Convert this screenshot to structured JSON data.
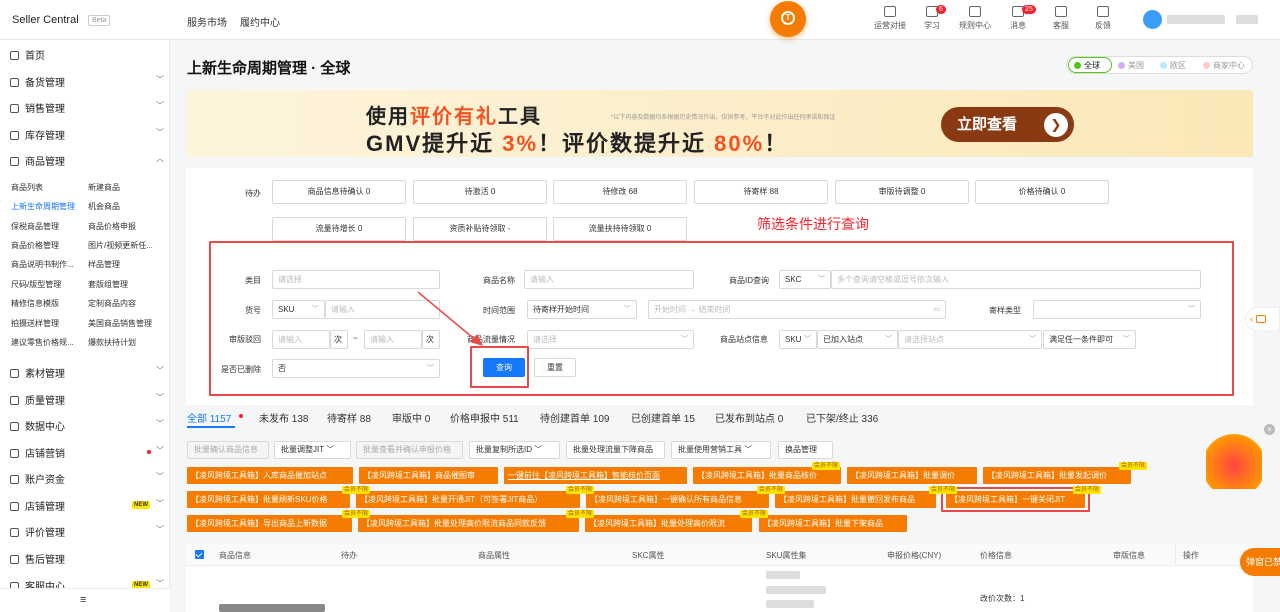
{
  "topbar": {
    "brand": "Seller Central",
    "beta": "Beta",
    "nav": [
      "服务市场",
      "履约中心"
    ],
    "logo_letter": "T",
    "icons": [
      {
        "name": "operations-icon",
        "label": "运营对接",
        "badge": ""
      },
      {
        "name": "learn-icon",
        "label": "学习",
        "badge": "6"
      },
      {
        "name": "rules-icon",
        "label": "规则中心",
        "badge": ""
      },
      {
        "name": "message-icon",
        "label": "消息",
        "badge": "25"
      },
      {
        "name": "customer-service-icon",
        "label": "客服",
        "badge": ""
      },
      {
        "name": "feedback-icon",
        "label": "反馈",
        "badge": ""
      }
    ]
  },
  "sidebar": {
    "menus": [
      {
        "label": "首页",
        "chev": ""
      },
      {
        "label": "备货管理",
        "chev": "﹀"
      },
      {
        "label": "销售管理",
        "chev": "﹀"
      },
      {
        "label": "库存管理",
        "chev": "﹀"
      },
      {
        "label": "商品管理",
        "chev": "︿"
      }
    ],
    "subs": [
      [
        "商品列表",
        "新建商品"
      ],
      [
        "上新生命周期管理",
        "机会商品"
      ],
      [
        "保税商品管理",
        "商品价格申报"
      ],
      [
        "商品价格管理",
        "图片/视频更新任..."
      ],
      [
        "商品说明书制作...",
        "样品管理"
      ],
      [
        "尺码/版型管理",
        "套版组管理"
      ],
      [
        "精修信息模版",
        "定制商品内容"
      ],
      [
        "拍摄送样管理",
        "美国商品销售管理"
      ],
      [
        "建议零售价格规...",
        "爆款扶持计划"
      ]
    ],
    "menus2": [
      {
        "label": "素材管理",
        "chev": "﹀"
      },
      {
        "label": "质量管理",
        "chev": "﹀"
      },
      {
        "label": "数据中心",
        "chev": "﹀"
      },
      {
        "label": "店铺营销",
        "chev": "﹀"
      },
      {
        "label": "账户资金",
        "chev": "﹀"
      },
      {
        "label": "店铺管理",
        "chev": "﹀"
      },
      {
        "label": "评价管理",
        "chev": "﹀"
      },
      {
        "label": "售后管理",
        "chev": ""
      },
      {
        "label": "客服中心",
        "chev": "﹀"
      }
    ],
    "new_tag": "NEW",
    "collapse_icon": "≡"
  },
  "page": {
    "title": "上新生命周期管理 · 全球",
    "regions": [
      "全球",
      "美国",
      "欧区",
      "商家中心"
    ],
    "region_colors": [
      "#52c41a",
      "#b37feb",
      "#69c0ff",
      "#ff7875"
    ]
  },
  "banner": {
    "line1_a": "使用",
    "line1_hl": "评价有礼",
    "line1_b": "工具",
    "line2_a": "GMV提升近 ",
    "line2_hl1": "3%",
    "line2_b": "！评价数提升近 ",
    "line2_hl2": "80%",
    "line2_c": "！",
    "note": "*以下内容及数据均系根据历史情况作出，仅供参考。平台不对此作出任何承诺和保证",
    "cta": "立即查看",
    "cta_arrow": "❯"
  },
  "todo": {
    "label": "待办",
    "items": [
      "商品信息待确认 0",
      "待激活 0",
      "待修改 68",
      "待寄样 88",
      "审版待调整 0",
      "价格待确认 0",
      "流量待增长 0",
      "资质补贴待领取 -",
      "流量扶持待领取 0"
    ]
  },
  "annotation": "筛选条件进行查询",
  "filters": {
    "category_label": "类目",
    "category_ph": "请选择",
    "product_name_label": "商品名称",
    "product_name_ph": "请输入",
    "product_id_label": "商品ID查询",
    "product_id_type": "SKC",
    "product_id_ph": "多个查询请空格或逗号依次输入",
    "sku_label": "货号",
    "sku_type": "SKU",
    "sku_ph": "请输入",
    "time_label": "时间范围",
    "time_type": "待寄样开始时间",
    "time_start_ph": "开始时间",
    "time_sep": "→",
    "time_end_ph": "结束时间",
    "sample_label": "寄样类型",
    "review_label": "审版驳回",
    "review_min_ph": "请输入",
    "review_unit": "次",
    "review_sep": "~",
    "review_max_ph": "请输入",
    "traffic_label": "商品流量情况",
    "traffic_ph": "请选择",
    "site_label": "商品站点信息",
    "site_type": "SKU",
    "site_status": "已加入站点",
    "site_ph": "请选择站点",
    "site_match": "满足任一条件即可",
    "deleted_label": "是否已删除",
    "deleted_value": "否",
    "query_btn": "查询",
    "reset_btn": "重置"
  },
  "status_tabs": [
    "全部 1157",
    "未发布 138",
    "待寄样 88",
    "审版中 0",
    "价格申报中 511",
    "待创建首单 109",
    "已创建首单 15",
    "已发布到站点 0",
    "已下架/终止 336"
  ],
  "actions": [
    "批量确认商品信息",
    "批量调整JIT",
    "批量查看并确认申报价格",
    "批量复制所选ID",
    "批量处理流量下降商品",
    "批量使用营销工具",
    "换品管理"
  ],
  "tools": {
    "row1": [
      "【凌风跨境工具箱】入库商品催加站点",
      "【凌风跨境工具箱】商品催图审",
      "一键前往【凌风跨境工具箱】智能核价页面",
      "【凌风跨境工具箱】批量商品核价",
      "【凌风跨境工具箱】批量调价",
      "【凌风跨境工具箱】批量发起调价"
    ],
    "row2": [
      "【凌风跨境工具箱】批量刷新SKU价格",
      "【凌风跨境工具箱】批量开通JIT（可签署JIT商品）",
      "【凌风跨境工具箱】一键确认所有商品信息",
      "【凌风跨境工具箱】批量撤回发布商品",
      "【凌风跨境工具箱】一键关闭JIT"
    ],
    "row3": [
      "【凌风跨境工具箱】导出商品上新数据",
      "【凌风跨境工具箱】批量处理高价限流商品同款反馈",
      "【凌风跨境工具箱】批量处理高价限流",
      "【凌风跨境工具箱】批量下架商品"
    ],
    "member_tag": "会员不限"
  },
  "table": {
    "headers": [
      "商品信息",
      "待办",
      "商品属性",
      "SKC属性",
      "SKU属性集",
      "申报价格(CNY)",
      "价格信息",
      "审版信息",
      "操作"
    ],
    "price_change": "改价次数：1"
  },
  "float_btn": "弹窗已禁",
  "side_tab": "‹",
  "promo_close": "×"
}
